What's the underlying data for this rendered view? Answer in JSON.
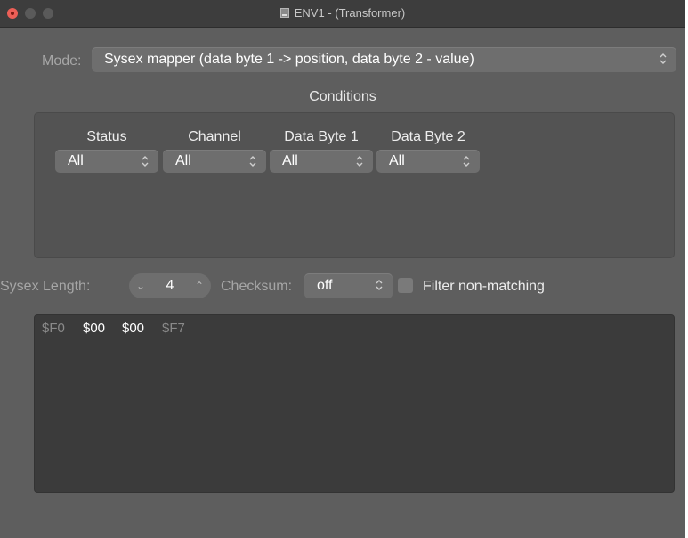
{
  "window": {
    "title": "ENV1 - (Transformer)"
  },
  "mode": {
    "label": "Mode:",
    "value": "Sysex mapper (data byte 1 -> position, data byte 2 - value)"
  },
  "conditions": {
    "title": "Conditions",
    "columns": [
      {
        "header": "Status",
        "value": "All"
      },
      {
        "header": "Channel",
        "value": "All"
      },
      {
        "header": "Data Byte 1",
        "value": "All"
      },
      {
        "header": "Data Byte 2",
        "value": "All"
      }
    ]
  },
  "sysex": {
    "length_label": "Sysex Length:",
    "length_value": "4",
    "checksum_label": "Checksum:",
    "checksum_value": "off",
    "filter_label": "Filter non-matching",
    "filter_checked": false
  },
  "editor": {
    "bytes": [
      "$F0",
      "$00",
      "$00",
      "$F7"
    ]
  },
  "colors": {
    "close_button": "#ec5f57",
    "window_bg": "#5e5e5e",
    "panel_bg": "#535353",
    "editor_bg": "#3b3b3b"
  }
}
